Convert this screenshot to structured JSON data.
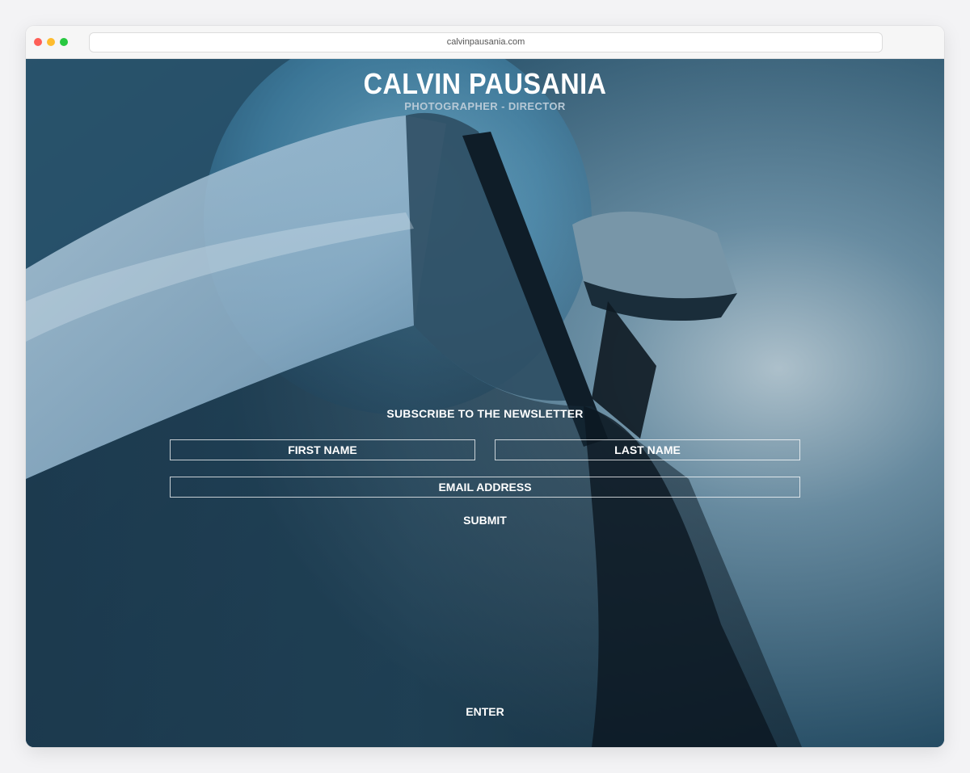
{
  "browser": {
    "url": "calvinpausania.com"
  },
  "hero": {
    "title": "CALVIN PAUSANIA",
    "subtitle": "PHOTOGRAPHER - DIRECTOR",
    "background_image": "car-photo"
  },
  "newsletter": {
    "heading": "SUBSCRIBE TO THE NEWSLETTER",
    "first_name_placeholder": "FIRST NAME",
    "last_name_placeholder": "LAST NAME",
    "email_placeholder": "EMAIL ADDRESS",
    "submit_label": "SUBMIT"
  },
  "enter_label": "ENTER",
  "colors": {
    "window_controls": [
      "#fe5f57",
      "#febc2e",
      "#28c840"
    ],
    "background_tone": "#2c5873",
    "text": "#ffffff",
    "subtitle": "#b7c9d6"
  }
}
